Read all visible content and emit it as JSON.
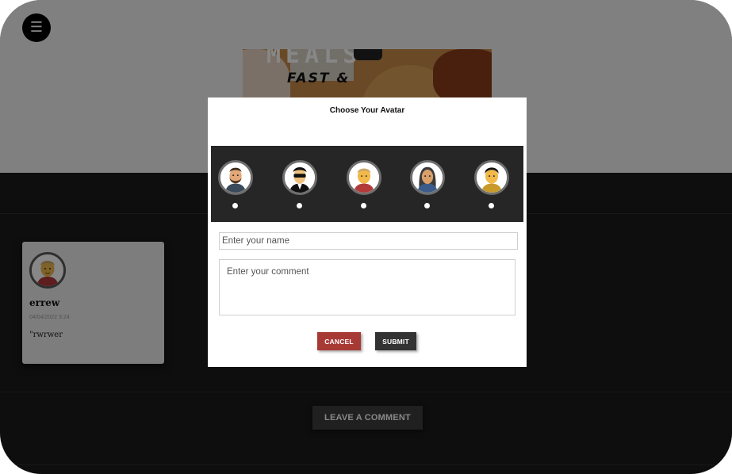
{
  "header": {
    "menu_icon": "hamburger-menu-icon",
    "menu_glyph": "☰"
  },
  "video": {
    "title_text": "FAST &",
    "top_text": "MEALS"
  },
  "comments": [
    {
      "name": "errew",
      "date": "04/04/2022 3:24",
      "text": "\"rwrwer"
    }
  ],
  "leave_comment_label": "LEAVE A COMMENT",
  "modal": {
    "title": "Choose Your Avatar",
    "avatars": [
      {
        "id": "bearded-man-avatar-icon"
      },
      {
        "id": "sunglasses-man-avatar-icon"
      },
      {
        "id": "blond-man-avatar-icon"
      },
      {
        "id": "dark-hair-woman-avatar-icon"
      },
      {
        "id": "black-hair-man-avatar-icon"
      }
    ],
    "name_placeholder": "Enter your name",
    "comment_placeholder": "Enter your comment",
    "cancel_label": "CANCEL",
    "submit_label": "SUBMIT"
  },
  "colors": {
    "cancel": "#a83a36",
    "submit": "#333333",
    "dark_bg": "#1b1b1b",
    "strip": "#262626"
  }
}
